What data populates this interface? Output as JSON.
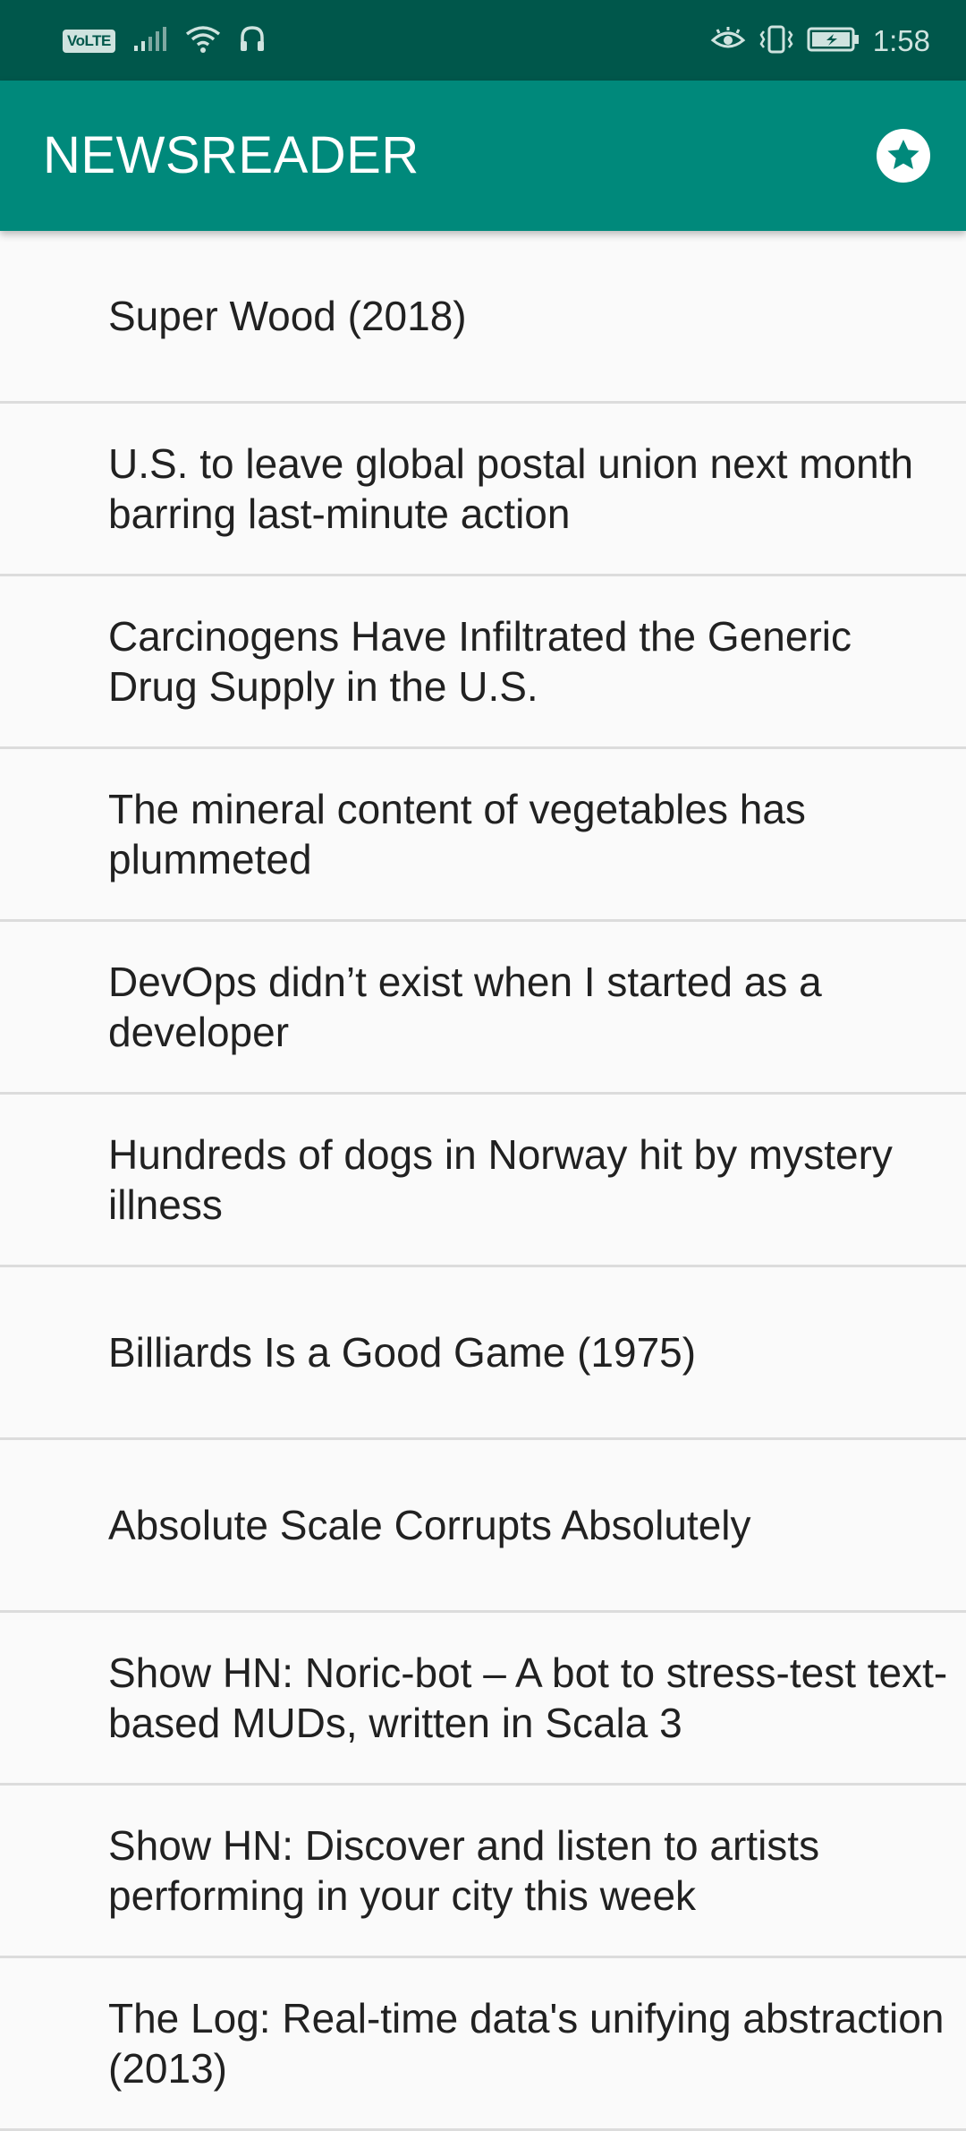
{
  "status_bar": {
    "volte_label": "VoLTE",
    "time": "1:58"
  },
  "app_bar": {
    "title": "NEWSREADER",
    "action_icon": "star-circle-icon"
  },
  "articles": [
    {
      "title": "Super Wood (2018)"
    },
    {
      "title": "U.S. to leave global postal union next month barring last-minute action"
    },
    {
      "title": "Carcinogens Have Infiltrated the Generic Drug Supply in the U.S."
    },
    {
      "title": "The mineral content of vegetables has plummeted"
    },
    {
      "title": "DevOps didn’t exist when I started as a developer"
    },
    {
      "title": "Hundreds of dogs in Norway hit by mystery illness"
    },
    {
      "title": "Billiards Is a Good Game (1975)"
    },
    {
      "title": "Absolute Scale Corrupts Absolutely"
    },
    {
      "title": "Show HN: Noric-bot – A bot to stress-test text-based MUDs, written in Scala 3"
    },
    {
      "title": "Show HN: Discover and listen to artists performing in your city this week"
    },
    {
      "title": "The Log: Real-time data's unifying abstraction (2013)"
    }
  ],
  "colors": {
    "status_bar": "#00574b",
    "app_bar": "#00897b",
    "background": "#fafafa",
    "divider": "#dcdcdc",
    "text": "#212121"
  }
}
